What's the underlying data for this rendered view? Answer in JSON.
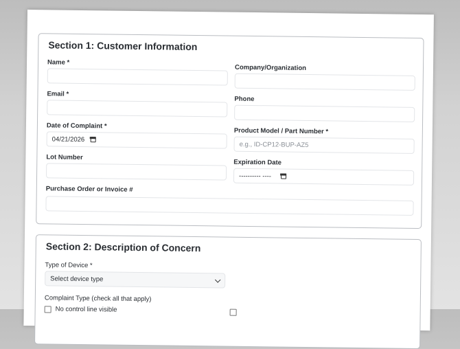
{
  "section1": {
    "title": "Section 1: Customer Information",
    "name_label": "Name *",
    "company_label": "Company/Organization",
    "email_label": "Email *",
    "phone_label": "Phone",
    "date_label": "Date of Complaint *",
    "date_value": "04/21/2026",
    "product_label": "Product Model / Part Number *",
    "product_placeholder": "e.g., ID-CP12-BUP-AZ5",
    "lot_label": "Lot Number",
    "expiration_label": "Expiration Date",
    "expiration_value": "---------- ----",
    "po_label": "Purchase Order or Invoice #"
  },
  "section2": {
    "title": "Section 2: Description of Concern",
    "device_label": "Type of Device *",
    "device_value": "Select device type",
    "complaint_label": "Complaint Type (check all that apply)",
    "option1": "No control line visible"
  }
}
